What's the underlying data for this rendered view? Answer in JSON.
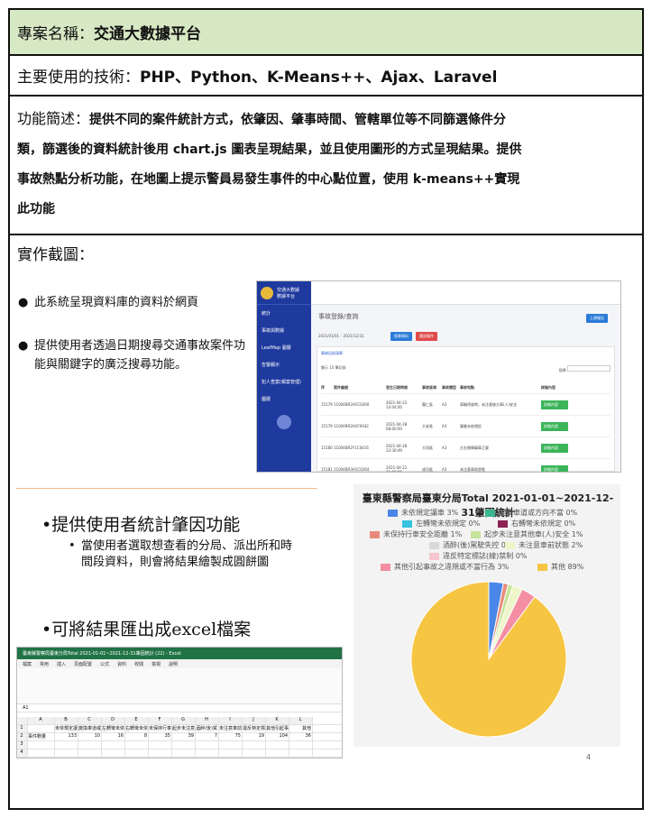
{
  "project": {
    "label": "專案名稱：",
    "value": "交通大數據平台"
  },
  "tech": {
    "label": "主要使用的技術：",
    "value": "PHP、Python、K-Means++、Ajax、Laravel"
  },
  "summary": {
    "label": "功能簡述：",
    "lines": [
      "提供不同的案件統計方式，依肇因、肇事時間、管轄單位等不同篩選條件分",
      "類，篩選後的資料統計後用 chart.js 圖表呈現結果，並且使用圖形的方式呈現結果。提供",
      "事故熱點分析功能，在地圖上提示警員易發生事件的中心點位置，使用 k-means++實現",
      "此功能"
    ]
  },
  "screens_label": "實作截圖：",
  "bullets1": [
    "此系統呈現資料庫的資料於網頁",
    "提供使用者透過日期搜尋交通事故案件功能與關鍵字的廣泛搜尋功能。"
  ],
  "bullets2": {
    "main1": "提供使用者統計肇因功能",
    "sub": "當使用者選取想查看的分局、派出所和時間段資料，則會將結果繪製成圓餅圖",
    "main2": "可將結果匯出成excel檔案"
  },
  "web": {
    "brand": "交通大數據",
    "brand_sub": "數據平台",
    "menu": [
      "統計",
      "事故與數據",
      "LeafMap 圖層",
      "告警顯示",
      "犯人查案(報案管理)",
      "圖層"
    ],
    "page_title": "事故登錄/查詢",
    "upload": "上傳報告",
    "date_from": "2021/01/01",
    "date_to": "2021/12/31",
    "search": "搜尋資料",
    "reset": "重設條件",
    "card_title": "事故記錄清單",
    "show": "顯示",
    "show_count": "10",
    "entries": "筆記錄",
    "filter": "搜尋",
    "headers": [
      "序",
      "案件編號",
      "發生日期時間",
      "事故區域",
      "事故類型",
      "事故地點",
      "詳細內容"
    ],
    "rows": [
      [
        "15179",
        "11004BR2H1C0260",
        "2021-04-22 14:04:00",
        "龍仁區",
        "A3",
        "車輛停放時，未注意後方車(人)安全",
        "詳細內容"
      ],
      [
        "15179",
        "11004BR2H1F0042",
        "2021-04-28 08:00:00",
        "大安區",
        "A3",
        "駕駛未依規定",
        "詳細內容"
      ],
      [
        "15180",
        "11004BR2Y1C0416",
        "2021-04-28 23:30:49",
        "大同區",
        "A3",
        "左右側障礙車正要",
        "詳細內容"
      ],
      [
        "15181",
        "11004BR3H1C0264",
        "2021-04-22 11:00:05",
        "成功區",
        "A3",
        "未注意車前狀態",
        "詳細內容"
      ]
    ]
  },
  "chart_data": {
    "type": "pie",
    "title": "臺東縣警察局臺東分局Total 2021-01-01~2021-12-31肇因統計",
    "legend": [
      {
        "name": "未依規定讓車 3%",
        "color": "#4a86e8"
      },
      {
        "name": "變換車道或方向不當 0%",
        "color": "#3bb58f"
      },
      {
        "name": "左轉彎未依規定 0%",
        "color": "#35c3e0"
      },
      {
        "name": "右轉彎未依規定 0%",
        "color": "#8b2252"
      },
      {
        "name": "未保持行車安全距離 1%",
        "color": "#e98b7c"
      },
      {
        "name": "起步未注意其他車(人)安全 1%",
        "color": "#c7e39b"
      },
      {
        "name": "酒醉(後)駕駛失控 0%",
        "color": "#d9d9d9"
      },
      {
        "name": "未注意車前狀態 2%",
        "color": "#eef5c9"
      },
      {
        "name": "違反特定標誌(線)禁制 0%",
        "color": "#f5c6cb"
      },
      {
        "name": "其他引起事故之違規或不當行為 3%",
        "color": "#f48ea3"
      },
      {
        "name": "其他 89%",
        "color": "#f6c542"
      }
    ],
    "values": [
      3,
      0,
      0,
      0,
      1,
      1,
      0,
      2,
      0,
      3,
      89
    ]
  },
  "excel": {
    "title": "臺東縣警察局臺東分局Total 2021-01-01~2021-12-31肇因統計 (22) - Excel",
    "menu": [
      "檔案",
      "常用",
      "插入",
      "頁面配置",
      "公式",
      "資料",
      "校閱",
      "檢視",
      "說明"
    ],
    "cell_ref": "A1",
    "columns": [
      "A",
      "B",
      "C",
      "D",
      "E",
      "F",
      "G",
      "H",
      "I",
      "J",
      "K",
      "L"
    ],
    "header_row": [
      "",
      "未依規定讓",
      "變換車道或",
      "左轉彎未依",
      "右轉彎未依",
      "未保持行車",
      "起步未注意",
      "酒醉(後)駕",
      "未注意車前",
      "違反特定標",
      "其他引起事",
      "其他"
    ],
    "data_row": [
      "事件數量",
      "133",
      "10",
      "16",
      "8",
      "35",
      "39",
      "7",
      "75",
      "19",
      "104",
      "36"
    ]
  },
  "page_number": "4"
}
